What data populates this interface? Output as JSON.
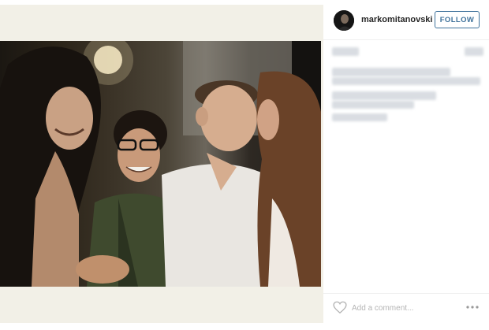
{
  "post": {
    "username": "markomitanovski",
    "follow_label": "FOLLOW",
    "comment_placeholder": "Add a comment...",
    "photo_alt": ""
  },
  "colors": {
    "follow_accent": "#3f729b",
    "panel_background": "#f2f0e7",
    "redaction_blur": "#d9dde2"
  },
  "icons": {
    "like": "heart-outline-icon",
    "more": "ellipsis-icon"
  }
}
